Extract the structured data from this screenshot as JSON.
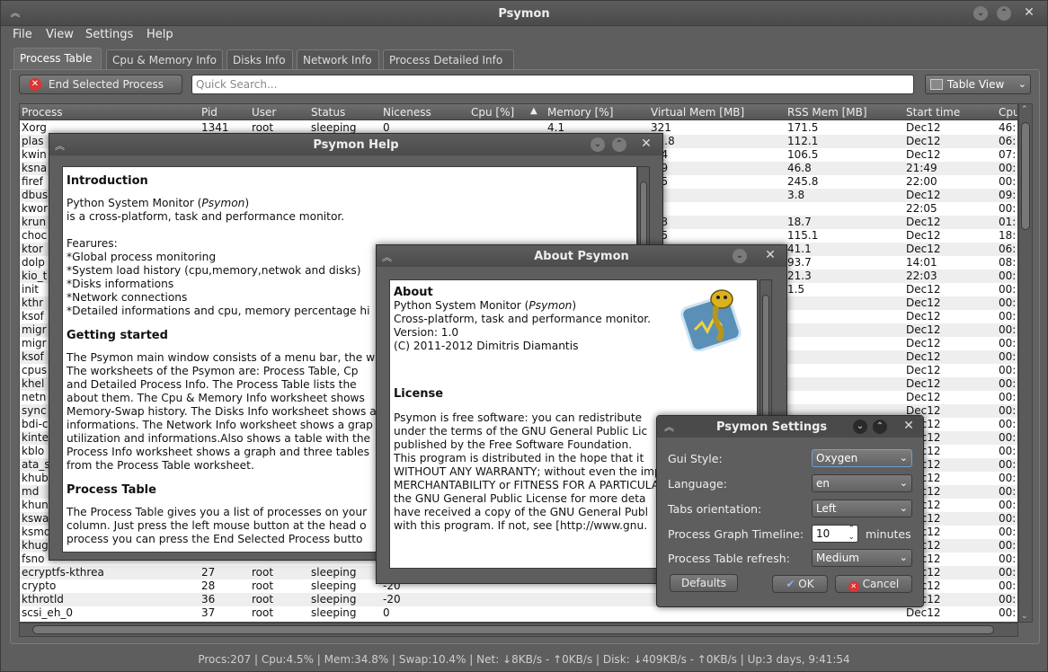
{
  "window": {
    "title": "Psymon"
  },
  "menu": [
    "File",
    "View",
    "Settings",
    "Help"
  ],
  "tabs": [
    "Process Table",
    "Cpu & Memory Info",
    "Disks Info",
    "Network Info",
    "Process Detailed Info"
  ],
  "toolbar": {
    "end_process": "End Selected Process",
    "search_placeholder": "Quick Search...",
    "view_select": "Table View"
  },
  "table": {
    "headers": [
      "Process",
      "Pid",
      "User",
      "Status",
      "Niceness",
      "Cpu [%]",
      "Memory [%]",
      "Virtual Mem [MB]",
      "RSS Mem [MB]",
      "Start time",
      "Cpu"
    ],
    "rows": [
      [
        "Xorg",
        "1341",
        "root",
        "sleeping",
        "0",
        "",
        "4.1",
        "321",
        "171.5",
        "Dec12",
        "46:"
      ],
      [
        "plas",
        "",
        "",
        "",
        "",
        "",
        "",
        "32.8",
        "112.1",
        "Dec12",
        "06:"
      ],
      [
        "kwin",
        "",
        "",
        "",
        "",
        "",
        "",
        "9.4",
        "106.5",
        "Dec12",
        "07:"
      ],
      [
        "ksna",
        "",
        "",
        "",
        "",
        "",
        "",
        "3.9",
        "46.8",
        "21:49",
        "00:"
      ],
      [
        "firef",
        "",
        "",
        "",
        "",
        "",
        "",
        "6.5",
        "245.8",
        "22:00",
        "00:"
      ],
      [
        "dbus",
        "",
        "",
        "",
        "",
        "",
        "",
        ".1",
        "3.8",
        "Dec12",
        "09:"
      ],
      [
        "kwor",
        "",
        "",
        "",
        "",
        "",
        "",
        "",
        "",
        "22:05",
        "00:"
      ],
      [
        "krun",
        "",
        "",
        "",
        "",
        "",
        "",
        "2.3",
        "18.7",
        "Dec12",
        "01:"
      ],
      [
        "choc",
        "",
        "",
        "",
        "",
        "",
        "",
        "8.5",
        "115.1",
        "Dec12",
        "18:"
      ],
      [
        "ktor",
        "",
        "",
        "",
        "",
        "",
        "",
        "",
        "41.1",
        "Dec12",
        "06:"
      ],
      [
        "dolp",
        "",
        "",
        "",
        "",
        "",
        "",
        "",
        "93.7",
        "14:01",
        "08:"
      ],
      [
        "kio_t",
        "",
        "",
        "",
        "",
        "",
        "",
        "",
        "21.3",
        "22:03",
        "00:"
      ],
      [
        "init",
        "",
        "",
        "",
        "",
        "",
        "",
        "",
        "1.5",
        "Dec12",
        "00:"
      ],
      [
        "kthr",
        "",
        "",
        "",
        "",
        "",
        "",
        "",
        "",
        "Dec12",
        "00:"
      ],
      [
        "ksof",
        "",
        "",
        "",
        "",
        "",
        "",
        "",
        "",
        "Dec12",
        "00:"
      ],
      [
        "migr",
        "",
        "",
        "",
        "",
        "",
        "",
        "",
        "",
        "Dec12",
        "00:"
      ],
      [
        "migr",
        "",
        "",
        "",
        "",
        "",
        "",
        "",
        "",
        "Dec12",
        "00:"
      ],
      [
        "ksof",
        "",
        "",
        "",
        "",
        "",
        "",
        "",
        "",
        "Dec12",
        "00:"
      ],
      [
        "cpus",
        "",
        "",
        "",
        "",
        "",
        "",
        "",
        "",
        "Dec12",
        "00:"
      ],
      [
        "khel",
        "",
        "",
        "",
        "",
        "",
        "",
        "",
        "",
        "Dec12",
        "00:"
      ],
      [
        "netn",
        "",
        "",
        "",
        "",
        "",
        "",
        "",
        "",
        "Dec12",
        "00:"
      ],
      [
        "sync",
        "",
        "",
        "",
        "",
        "",
        "",
        "",
        "",
        "Dec12",
        "00:"
      ],
      [
        "bdi-c",
        "",
        "",
        "",
        "",
        "",
        "",
        "",
        "",
        "Dec12",
        "00:"
      ],
      [
        "kinte",
        "",
        "",
        "",
        "",
        "",
        "",
        "",
        "",
        "Dec12",
        "00:"
      ],
      [
        "kblo",
        "",
        "",
        "",
        "",
        "",
        "",
        "",
        "",
        "Dec12",
        "00:"
      ],
      [
        "ata_s",
        "",
        "",
        "",
        "",
        "",
        "",
        "",
        "",
        "Dec12",
        "00:"
      ],
      [
        "khub",
        "",
        "",
        "",
        "",
        "",
        "",
        "",
        "",
        "Dec12",
        "00:"
      ],
      [
        "md",
        "",
        "",
        "",
        "",
        "",
        "",
        "",
        "",
        "Dec12",
        "00:"
      ],
      [
        "khun",
        "",
        "",
        "",
        "",
        "",
        "",
        "",
        "",
        "Dec12",
        "00:"
      ],
      [
        "kswa",
        "",
        "",
        "",
        "",
        "",
        "",
        "",
        "",
        "Dec12",
        "00:"
      ],
      [
        "ksmd",
        "",
        "",
        "",
        "",
        "",
        "",
        "",
        "",
        "Dec12",
        "00:"
      ],
      [
        "khug",
        "",
        "",
        "",
        "",
        "",
        "",
        "",
        "",
        "Dec12",
        "00:"
      ],
      [
        "fsno",
        "",
        "",
        "",
        "",
        "",
        "",
        "",
        "",
        "Dec12",
        "00:"
      ],
      [
        "ecryptfs-kthrea",
        "27",
        "root",
        "sleeping",
        "0",
        "",
        "",
        "",
        "",
        "Dec12",
        "00:"
      ],
      [
        "crypto",
        "28",
        "root",
        "sleeping",
        "-20",
        "",
        "",
        "",
        "",
        "Dec12",
        "00:"
      ],
      [
        "kthrotld",
        "36",
        "root",
        "sleeping",
        "-20",
        "",
        "",
        "",
        "",
        "Dec12",
        "00:"
      ],
      [
        "scsi_eh_0",
        "37",
        "root",
        "sleeping",
        "0",
        "",
        "",
        "",
        "",
        "Dec12",
        "00:"
      ]
    ]
  },
  "statusbar": "Procs:207 | Cpu:4.5% | Mem:34.8% | Swap:10.4% | Net: ↓8KB/s - ↑0KB/s | Disk: ↓409KB/s - ↑0KB/s | Up:3 days, 9:41:54",
  "help": {
    "title": "Psymon Help",
    "intro_h": "Introduction",
    "intro_1": "Python System Monitor (",
    "intro_1i": "Psymon",
    "intro_1e": ")",
    "intro_2": "is a cross-platform, task and performance monitor.",
    "feat_h": "Fearures:",
    "feat": [
      "*Global process monitoring",
      "*System load history (cpu,memory,netwok and disks)",
      "*Disks informations",
      "*Network connections",
      "*Detailed informations and cpu, memory percentage hi"
    ],
    "gs_h": "Getting started",
    "gs": [
      "The Psymon main window consists of a menu bar, the w",
      "The worksheets of the Psymon are: Process Table, Cp",
      "and Detailed Process Info. The Process Table lists the",
      "about them. The Cpu & Memory Info worksheet shows",
      "Memory-Swap history. The Disks Info worksheet shows a",
      "informations. The Network Info worksheet shows a grap",
      "utilization and informations.Also shows a table with the",
      "Process Info worksheet shows a graph and three tables",
      "from the Process Table worksheet."
    ],
    "pt_h": "Process Table",
    "pt": [
      "The Process Table gives you a list of processes on your",
      "column. Just press the left mouse button at the head o",
      "process you can press the End Selected Process butto"
    ]
  },
  "about": {
    "title": "About Psymon",
    "h": "About",
    "l1": "Python System Monitor (",
    "l1i": "Psymon",
    "l1e": ")",
    "l2": "Cross-platform, task and performance monitor.",
    "l3": "Version: 1.0",
    "l4": "(C) 2011-2012 Dimitris Diamantis",
    "lic_h": "License",
    "lic": [
      "Psymon is free software: you can redistribute",
      "under the terms of the GNU General Public Lic",
      "published by the Free Software Foundation.",
      "This program is distributed in the hope that it",
      "WITHOUT ANY WARRANTY; without even the imp",
      "MERCHANTABILITY or FITNESS FOR A PARTICULAR",
      "the GNU General Public License for more deta",
      "have received a copy of the GNU General Publ",
      "with this program. If not, see [http://www.gnu."
    ]
  },
  "settings": {
    "title": "Psymon Settings",
    "gui_label": "Gui Style:",
    "gui_value": "Oxygen",
    "lang_label": "Language:",
    "lang_value": "en",
    "tabs_label": "Tabs orientation:",
    "tabs_value": "Left",
    "timeline_label": "Process Graph Timeline:",
    "timeline_value": "10",
    "timeline_unit": "minutes",
    "refresh_label": "Process Table refresh:",
    "refresh_value": "Medium",
    "defaults": "Defaults",
    "ok": "OK",
    "cancel": "Cancel"
  }
}
